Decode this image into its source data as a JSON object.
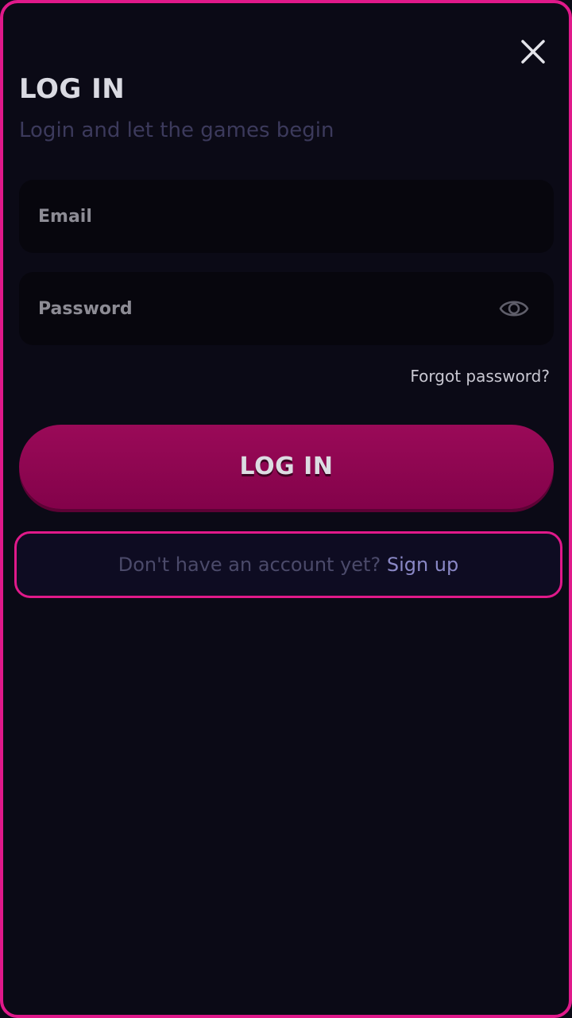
{
  "colors": {
    "accent_border": "#e0198a",
    "background": "#0b0a16",
    "login_button": "#8d0350",
    "signup_link": "#8a88c6"
  },
  "modal": {
    "close_icon": "close-icon",
    "title": "LOG IN",
    "subtitle": "Login and let the games begin"
  },
  "form": {
    "email": {
      "placeholder": "Email",
      "value": ""
    },
    "password": {
      "placeholder": "Password",
      "value": "",
      "toggle_icon": "eye-icon"
    },
    "forgot_password": "Forgot password?",
    "submit_label": "LOG IN"
  },
  "signup": {
    "prompt": "Don't have an account yet?",
    "link": "Sign up"
  }
}
